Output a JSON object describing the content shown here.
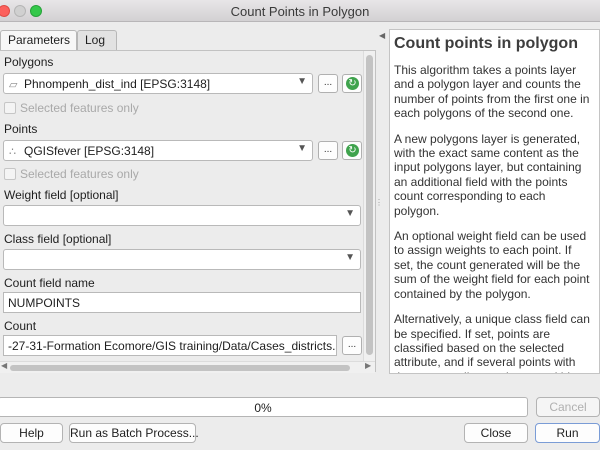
{
  "window": {
    "title": "Count Points in Polygon"
  },
  "tabs": [
    {
      "label": "Parameters"
    },
    {
      "label": "Log"
    }
  ],
  "parameters": {
    "polygons": {
      "label": "Polygons",
      "value": "Phnompenh_dist_ind [EPSG:3148]",
      "selected_only": "Selected features only",
      "icon": "polygon-layer-icon"
    },
    "points": {
      "label": "Points",
      "value": "QGISfever [EPSG:3148]",
      "selected_only": "Selected features only",
      "icon": "point-layer-icon"
    },
    "weight_field": {
      "label": "Weight field [optional]",
      "value": ""
    },
    "class_field": {
      "label": "Class field [optional]",
      "value": ""
    },
    "count_field": {
      "label": "Count field name",
      "value": "NUMPOINTS"
    },
    "count": {
      "label": "Count",
      "value": "-27-31-Formation Ecomore/GIS training/Data/Cases_districts.shp"
    },
    "ellipsis_label": "..."
  },
  "help": {
    "title": "Count points in polygon",
    "paragraphs": [
      "This algorithm takes a points layer and a polygon layer and counts the number of points from the first one in each polygons of the second one.",
      "A new polygons layer is generated, with the exact same content as the input polygons layer, but containing an additional field with the points count corresponding to each polygon.",
      "An optional weight field can be used to assign weights to each point. If set, the count generated will be the sum of the weight field for each point contained by the polygon.",
      "Alternatively, a unique class field can be specified. If set, points are classified based on the selected attribute, and if several points with the same attribute value are within the polygon, only one of them is"
    ]
  },
  "progress": {
    "value": 0,
    "label": "0%"
  },
  "buttons": {
    "cancel": "Cancel",
    "help": "Help",
    "batch": "Run as Batch Process...",
    "close": "Close",
    "run": "Run"
  },
  "colors": {
    "accent": "#3d84e9",
    "refresh": "#3fa34d"
  }
}
